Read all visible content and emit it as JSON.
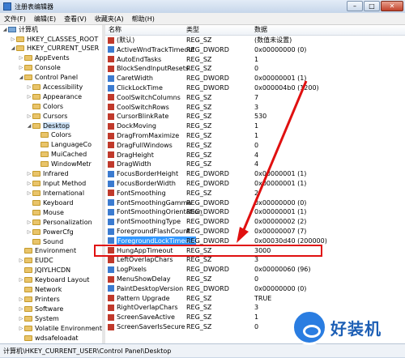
{
  "window": {
    "title": "注册表编辑器",
    "minimize": "–",
    "maximize": "□",
    "close": "✕"
  },
  "menu": [
    "文件(F)",
    "编辑(E)",
    "查看(V)",
    "收藏夹(A)",
    "帮助(H)"
  ],
  "tree": [
    {
      "label": "计算机",
      "tri": "◢"
    },
    {
      "label": "HKEY_CLASSES_ROOT",
      "tri": "▷"
    },
    {
      "label": "HKEY_CURRENT_USER",
      "tri": "◢"
    },
    {
      "label": "AppEvents",
      "tri": "▷"
    },
    {
      "label": "Console",
      "tri": "▷"
    },
    {
      "label": "Control Panel",
      "tri": "◢"
    },
    {
      "label": "Accessibility",
      "tri": "▷"
    },
    {
      "label": "Appearance",
      "tri": "▷"
    },
    {
      "label": "Colors",
      "tri": ""
    },
    {
      "label": "Cursors",
      "tri": "▷"
    },
    {
      "label": "Desktop",
      "tri": "◢"
    },
    {
      "label": "Colors",
      "tri": ""
    },
    {
      "label": "LanguageCo",
      "tri": ""
    },
    {
      "label": "MuiCached",
      "tri": ""
    },
    {
      "label": "WindowMetr",
      "tri": ""
    },
    {
      "label": "Infrared",
      "tri": "▷"
    },
    {
      "label": "Input Method",
      "tri": "▷"
    },
    {
      "label": "International",
      "tri": "▷"
    },
    {
      "label": "Keyboard",
      "tri": ""
    },
    {
      "label": "Mouse",
      "tri": ""
    },
    {
      "label": "Personalization",
      "tri": "▷"
    },
    {
      "label": "PowerCfg",
      "tri": "▷"
    },
    {
      "label": "Sound",
      "tri": ""
    },
    {
      "label": "Environment",
      "tri": ""
    },
    {
      "label": "EUDC",
      "tri": "▷"
    },
    {
      "label": "JQIYLHCDN",
      "tri": ""
    },
    {
      "label": "Keyboard Layout",
      "tri": "▷"
    },
    {
      "label": "Network",
      "tri": ""
    },
    {
      "label": "Printers",
      "tri": "▷"
    },
    {
      "label": "Software",
      "tri": "▷"
    },
    {
      "label": "System",
      "tri": "▷"
    },
    {
      "label": "Volatile Environment",
      "tri": "▷"
    },
    {
      "label": "wdsafeloadat",
      "tri": ""
    }
  ],
  "columns": {
    "name": "名称",
    "type": "类型",
    "data": "数据"
  },
  "values": [
    {
      "name": "(默认)",
      "type": "REG_SZ",
      "data": "(数值未设置)",
      "icon": "ab"
    },
    {
      "name": "ActiveWndTrackTimeout",
      "type": "REG_DWORD",
      "data": "0x00000000 (0)",
      "icon": "bin"
    },
    {
      "name": "AutoEndTasks",
      "type": "REG_SZ",
      "data": "1",
      "icon": "ab"
    },
    {
      "name": "BlockSendInputResets",
      "type": "REG_SZ",
      "data": "0",
      "icon": "ab"
    },
    {
      "name": "CaretWidth",
      "type": "REG_DWORD",
      "data": "0x00000001 (1)",
      "icon": "bin"
    },
    {
      "name": "ClickLockTime",
      "type": "REG_DWORD",
      "data": "0x000004b0 (1200)",
      "icon": "bin"
    },
    {
      "name": "CoolSwitchColumns",
      "type": "REG_SZ",
      "data": "7",
      "icon": "ab"
    },
    {
      "name": "CoolSwitchRows",
      "type": "REG_SZ",
      "data": "3",
      "icon": "ab"
    },
    {
      "name": "CursorBlinkRate",
      "type": "REG_SZ",
      "data": "530",
      "icon": "ab"
    },
    {
      "name": "DockMoving",
      "type": "REG_SZ",
      "data": "1",
      "icon": "ab"
    },
    {
      "name": "DragFromMaximize",
      "type": "REG_SZ",
      "data": "1",
      "icon": "ab"
    },
    {
      "name": "DragFullWindows",
      "type": "REG_SZ",
      "data": "0",
      "icon": "ab"
    },
    {
      "name": "DragHeight",
      "type": "REG_SZ",
      "data": "4",
      "icon": "ab"
    },
    {
      "name": "DragWidth",
      "type": "REG_SZ",
      "data": "4",
      "icon": "ab"
    },
    {
      "name": "FocusBorderHeight",
      "type": "REG_DWORD",
      "data": "0x00000001 (1)",
      "icon": "bin"
    },
    {
      "name": "FocusBorderWidth",
      "type": "REG_DWORD",
      "data": "0x00000001 (1)",
      "icon": "bin"
    },
    {
      "name": "FontSmoothing",
      "type": "REG_SZ",
      "data": "2",
      "icon": "ab"
    },
    {
      "name": "FontSmoothingGamma",
      "type": "REG_DWORD",
      "data": "0x00000000 (0)",
      "icon": "bin"
    },
    {
      "name": "FontSmoothingOrientation",
      "type": "REG_DWORD",
      "data": "0x00000001 (1)",
      "icon": "bin"
    },
    {
      "name": "FontSmoothingType",
      "type": "REG_DWORD",
      "data": "0x00000002 (2)",
      "icon": "bin"
    },
    {
      "name": "ForegroundFlashCount",
      "type": "REG_DWORD",
      "data": "0x00000007 (7)",
      "icon": "bin"
    },
    {
      "name": "ForegroundLockTimeout",
      "type": "REG_DWORD",
      "data": "0x00030d40 (200000)",
      "icon": "bin",
      "selected": true
    },
    {
      "name": "HungAppTimeout",
      "type": "REG_SZ",
      "data": "3000",
      "icon": "ab"
    },
    {
      "name": "LeftOverlapChars",
      "type": "REG_SZ",
      "data": "3",
      "icon": "ab"
    },
    {
      "name": "LogPixels",
      "type": "REG_DWORD",
      "data": "0x00000060 (96)",
      "icon": "bin"
    },
    {
      "name": "MenuShowDelay",
      "type": "REG_SZ",
      "data": "0",
      "icon": "ab"
    },
    {
      "name": "PaintDesktopVersion",
      "type": "REG_DWORD",
      "data": "0x00000000 (0)",
      "icon": "bin"
    },
    {
      "name": "Pattern Upgrade",
      "type": "REG_SZ",
      "data": "TRUE",
      "icon": "ab"
    },
    {
      "name": "RightOverlapChars",
      "type": "REG_SZ",
      "data": "3",
      "icon": "ab"
    },
    {
      "name": "ScreenSaveActive",
      "type": "REG_SZ",
      "data": "1",
      "icon": "ab"
    },
    {
      "name": "ScreenSaverIsSecure",
      "type": "REG_SZ",
      "data": "0",
      "icon": "ab"
    }
  ],
  "status": "计算机\\HKEY_CURRENT_USER\\Control Panel\\Desktop",
  "watermark": "好装机",
  "colors": {
    "highlight": "#e01010",
    "selection": "#3399ff"
  }
}
